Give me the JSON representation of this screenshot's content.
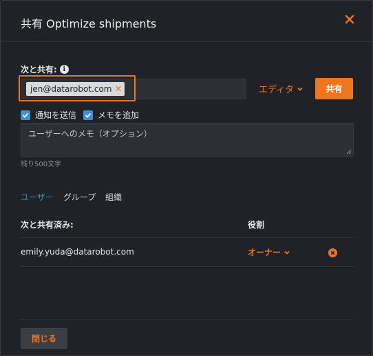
{
  "header": {
    "title": "共有 Optimize shipments"
  },
  "share_form": {
    "label": "次と共有:",
    "chip_email": "jen@datarobot.com",
    "role_selected": "エディタ",
    "share_button": "共有",
    "checkbox_notify": "通知を送信",
    "checkbox_memo": "メモを追加",
    "memo_placeholder": "ユーザーへのメモ（オプション）",
    "remaining": "残り500文字"
  },
  "tabs": [
    {
      "label": "ユーザー",
      "active": true
    },
    {
      "label": "グループ",
      "active": false
    },
    {
      "label": "組織",
      "active": false
    }
  ],
  "table": {
    "col_shared": "次と共有済み:",
    "col_role": "役割",
    "rows": [
      {
        "email": "emily.yuda@datarobot.com",
        "role": "オーナー"
      }
    ]
  },
  "footer": {
    "close_button": "閉じる"
  },
  "colors": {
    "accent": "#f0761e",
    "link": "#3d8fd8",
    "background": "#1f2226"
  }
}
